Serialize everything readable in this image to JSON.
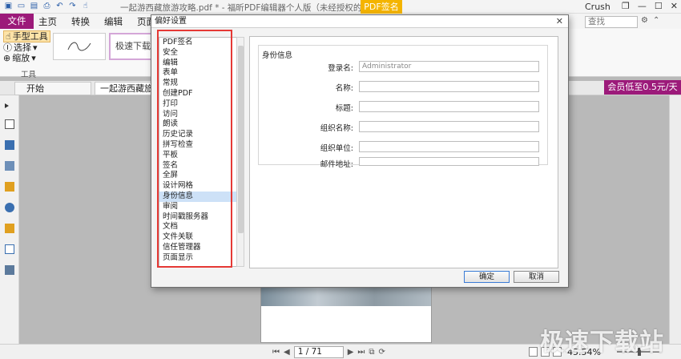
{
  "app": {
    "window_title": "一起游西藏旅游攻略.pdf * - 福昕PDF编辑器个人版（未经授权的产品）",
    "context_tab": "PDF签名",
    "user": "Crush",
    "search_placeholder": "查找"
  },
  "menu": {
    "file": "文件",
    "items": [
      "主页",
      "转换",
      "编辑",
      "页面管理"
    ]
  },
  "ribbon": {
    "tools": [
      "手型工具",
      "选择",
      "缩放"
    ],
    "tools_group": "工具",
    "signature_preview_text": "极速下载站"
  },
  "tabs": {
    "start": "开始",
    "document": "一起游西藏旅游攻略"
  },
  "promo": {
    "vip_text": "会员低至0.5元/天"
  },
  "status": {
    "page_value": "1 / 71",
    "zoom_percent": 45.54,
    "zoom_text": "45.54%"
  },
  "watermark": {
    "text": "极速下载站"
  },
  "dialog": {
    "title": "偏好设置",
    "nav_items": [
      "PDF签名",
      "安全",
      "编辑",
      "表单",
      "常规",
      "创建PDF",
      "打印",
      "访问",
      "朗读",
      "历史记录",
      "拼写检查",
      "平板",
      "签名",
      "全屏",
      "设计网格",
      "身份信息",
      "审阅",
      "时间戳服务器",
      "文档",
      "文件关联",
      "信任管理器",
      "页面显示"
    ],
    "selected_item": "身份信息",
    "panel": {
      "section_title": "身份信息",
      "fields": [
        {
          "label": "登录名:",
          "value": "Administrator"
        },
        {
          "label": "名称:",
          "value": ""
        },
        {
          "label": "标题:",
          "value": ""
        },
        {
          "label": "组织名称:",
          "value": ""
        },
        {
          "label": "组织单位:",
          "value": ""
        },
        {
          "label": "邮件地址:",
          "value": ""
        }
      ]
    },
    "buttons": {
      "ok": "确定",
      "cancel": "取消"
    }
  },
  "colors": {
    "accent_purple": "#9c1a7a",
    "pdf_sign_orange": "#f4b400",
    "highlight_red": "#e53935",
    "selection_blue": "#cde1f7"
  },
  "icons": [
    "save-icon",
    "open-icon",
    "print-icon",
    "undo-icon",
    "redo-icon",
    "hand-icon",
    "select-icon",
    "zoom-icon",
    "search-icon",
    "gear-icon",
    "close-icon"
  ]
}
